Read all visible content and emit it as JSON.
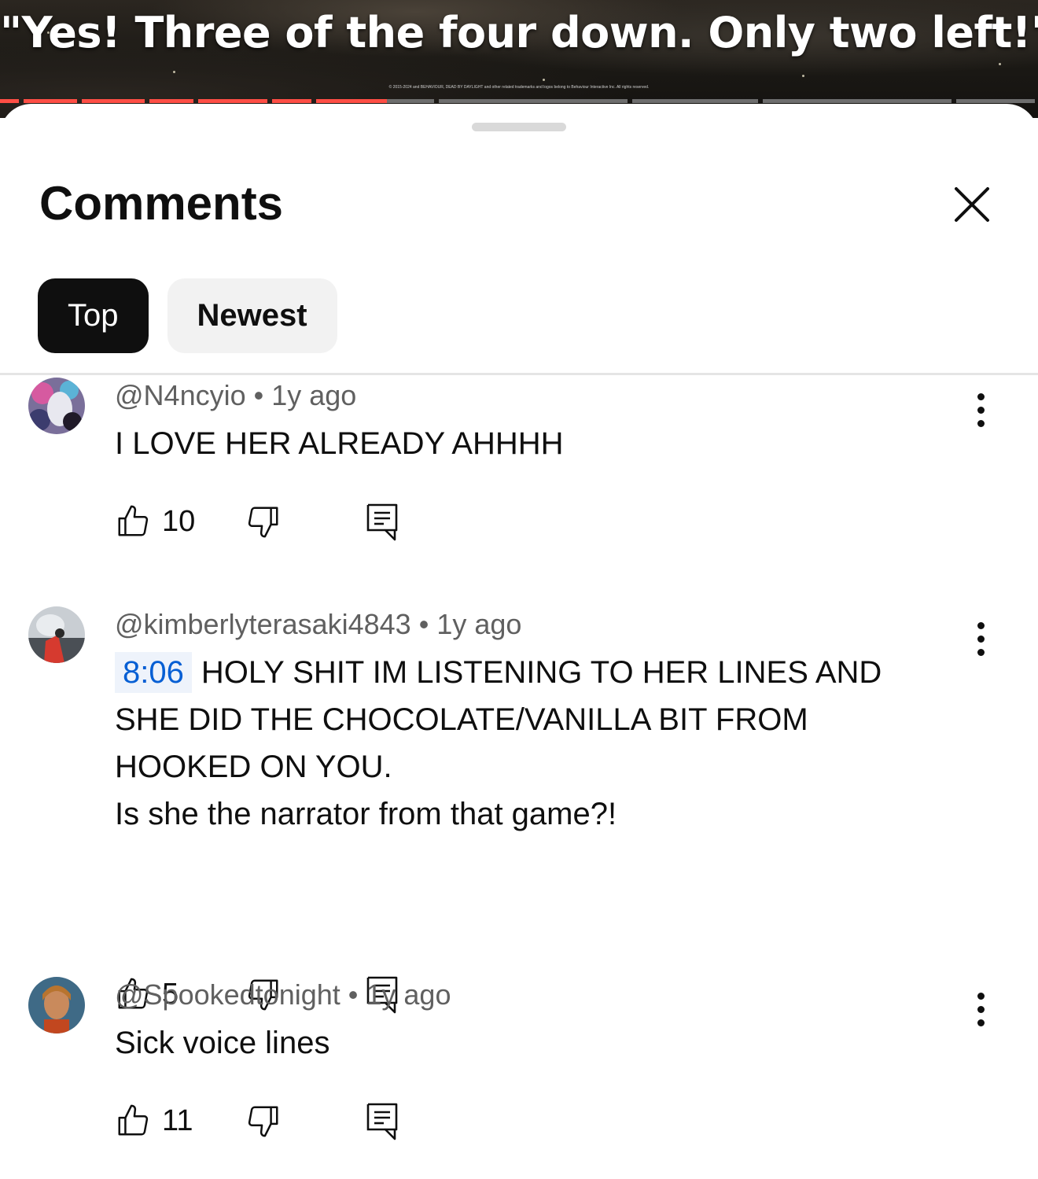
{
  "video": {
    "caption": "\"Yes! Three of the four down. Only two left!\"",
    "copyright": "© 2015-2024 and BEHAVIOUR, DEAD BY DAYLIGHT and other related trademarks and logos belong to Behaviour Interactive Inc. All rights reserved."
  },
  "sheet": {
    "title": "Comments",
    "close_icon": "close-icon"
  },
  "sort_chips": [
    {
      "label": "Top",
      "selected": true
    },
    {
      "label": "Newest",
      "selected": false
    }
  ],
  "comments": [
    {
      "author": "@N4ncyio",
      "time": "1y ago",
      "text": "I LOVE HER ALREADY AHHHH",
      "likes": "10"
    },
    {
      "author": "@kimberlyterasaki4843",
      "time": "1y ago",
      "timestamp": "8:06",
      "text_line1": "HOLY SHIT IM LISTENING TO HER LINES AND",
      "text_line2": "SHE DID THE CHOCOLATE/VANILLA BIT FROM",
      "text_line3": "HOOKED ON YOU.",
      "text_line4": "Is she the narrator from that game?!",
      "likes": "5"
    },
    {
      "author": "@Spookedtonight",
      "time": "1y ago",
      "text": "Sick voice lines",
      "likes": "11"
    }
  ],
  "meta_separator": "•",
  "colors": {
    "timestamp_link": "#065fd4",
    "chapter_played": "#ff4e45",
    "chapter_unplayed": "#6e6e6e"
  },
  "icons": [
    "close-icon",
    "like-icon",
    "dislike-icon",
    "reply-icon",
    "more-icon"
  ]
}
